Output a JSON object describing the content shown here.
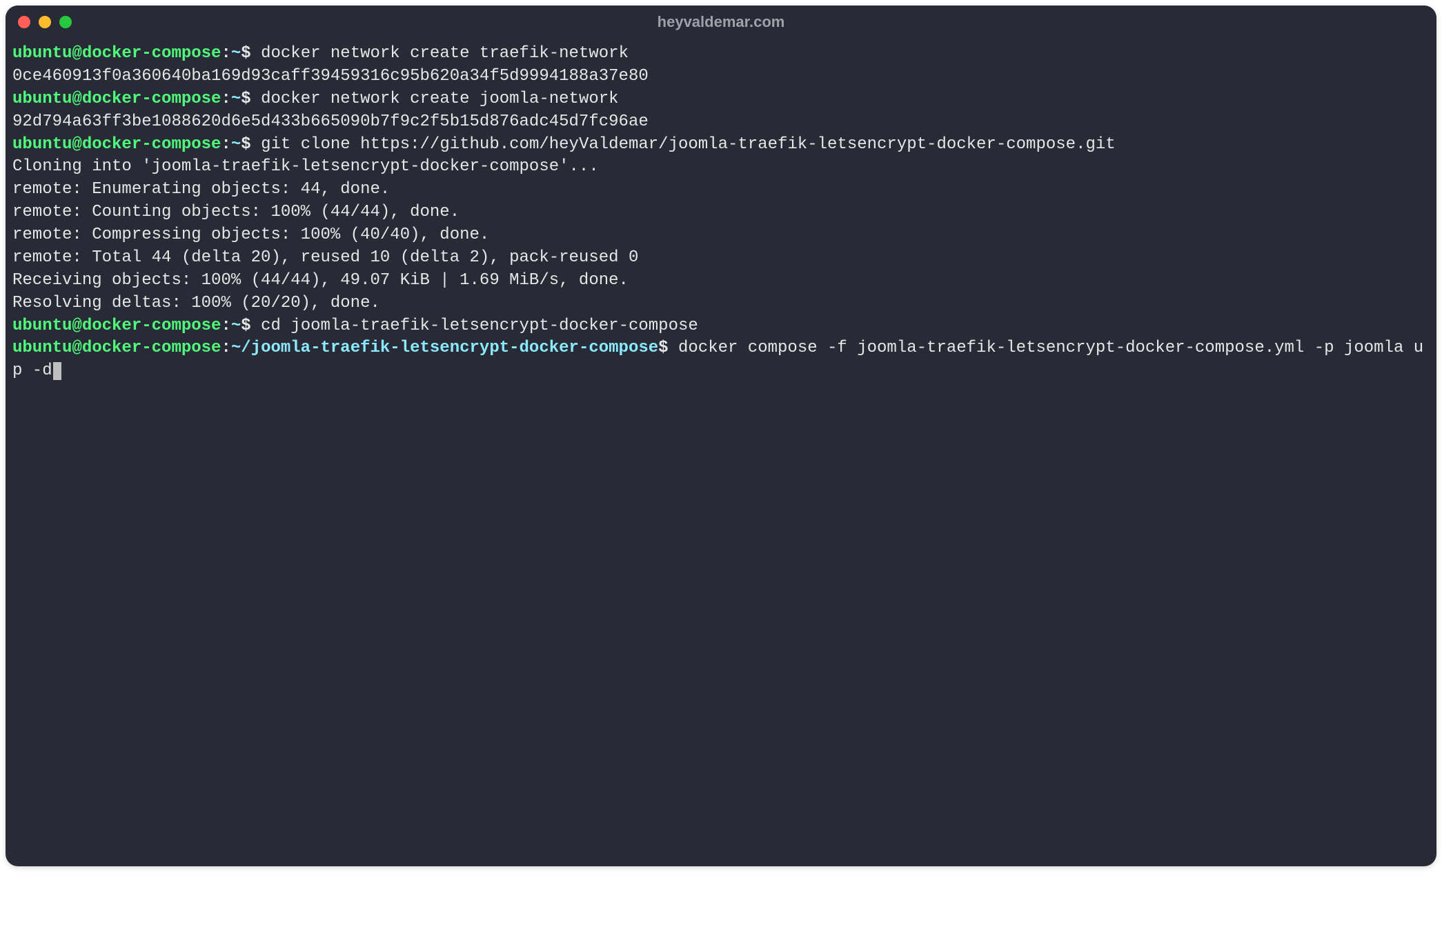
{
  "window": {
    "title": "heyvaldemar.com",
    "traffic_lights": {
      "close": "close",
      "minimize": "minimize",
      "maximize": "maximize"
    }
  },
  "colors": {
    "bg": "#282a36",
    "user_host": "#50fa7b",
    "path": "#8be9fd",
    "text": "#e6e6e6"
  },
  "prompt": {
    "user_host": "ubuntu@docker-compose",
    "colon": ":",
    "home": "~",
    "subdir": "~/joomla-traefik-letsencrypt-docker-compose",
    "dollar": "$"
  },
  "session": [
    {
      "type": "prompt",
      "path": "~",
      "cmd": "docker network create traefik-network"
    },
    {
      "type": "output",
      "text": "0ce460913f0a360640ba169d93caff39459316c95b620a34f5d9994188a37e80"
    },
    {
      "type": "prompt",
      "path": "~",
      "cmd": "docker network create joomla-network"
    },
    {
      "type": "output",
      "text": "92d794a63ff3be1088620d6e5d433b665090b7f9c2f5b15d876adc45d7fc96ae"
    },
    {
      "type": "prompt",
      "path": "~",
      "cmd": "git clone https://github.com/heyValdemar/joomla-traefik-letsencrypt-docker-compose.git"
    },
    {
      "type": "output",
      "text": "Cloning into 'joomla-traefik-letsencrypt-docker-compose'..."
    },
    {
      "type": "output",
      "text": "remote: Enumerating objects: 44, done."
    },
    {
      "type": "output",
      "text": "remote: Counting objects: 100% (44/44), done."
    },
    {
      "type": "output",
      "text": "remote: Compressing objects: 100% (40/40), done."
    },
    {
      "type": "output",
      "text": "remote: Total 44 (delta 20), reused 10 (delta 2), pack-reused 0"
    },
    {
      "type": "output",
      "text": "Receiving objects: 100% (44/44), 49.07 KiB | 1.69 MiB/s, done."
    },
    {
      "type": "output",
      "text": "Resolving deltas: 100% (20/20), done."
    },
    {
      "type": "prompt",
      "path": "~",
      "cmd": "cd joomla-traefik-letsencrypt-docker-compose"
    },
    {
      "type": "prompt",
      "path": "~/joomla-traefik-letsencrypt-docker-compose",
      "cmd": "docker compose -f joomla-traefik-letsencrypt-docker-compose.yml -p joomla up -d",
      "cursor": true
    }
  ]
}
